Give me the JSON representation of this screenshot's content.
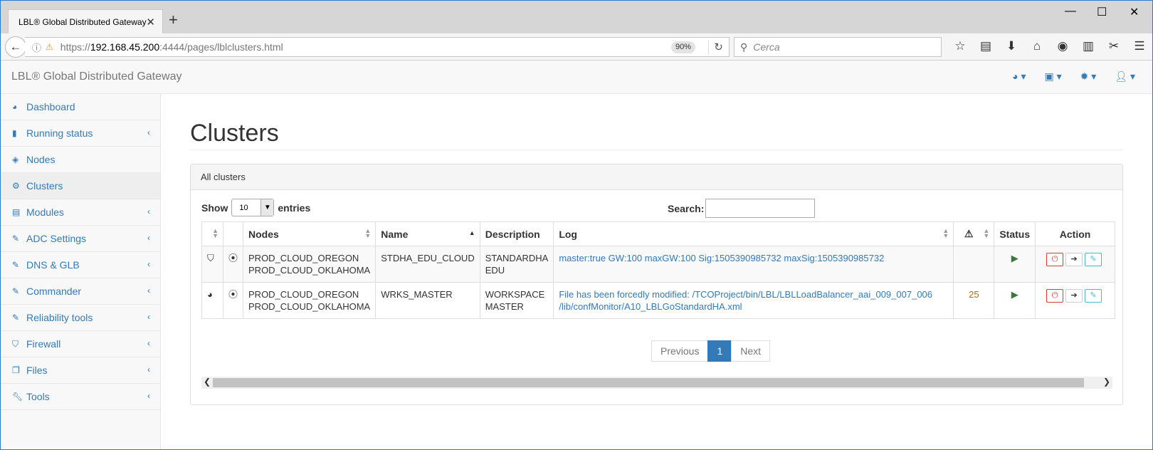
{
  "browser": {
    "tab_title": "LBL® Global Distributed Gateway",
    "url_prefix": "https://",
    "url_host": "192.168.45.200",
    "url_rest": ":4444/pages/lblclusters.html",
    "zoom": "90%",
    "search_placeholder": "Cerca"
  },
  "app": {
    "brand": "LBL® Global Distributed Gateway"
  },
  "sidebar": {
    "items": [
      {
        "label": "Dashboard",
        "icon": "dashboard-icon",
        "chevron": false
      },
      {
        "label": "Running status",
        "icon": "bar-chart-icon",
        "chevron": true
      },
      {
        "label": "Nodes",
        "icon": "cube-icon",
        "chevron": false
      },
      {
        "label": "Clusters",
        "icon": "cogs-icon",
        "chevron": false,
        "active": true
      },
      {
        "label": "Modules",
        "icon": "list-icon",
        "chevron": true
      },
      {
        "label": "ADC Settings",
        "icon": "edit-icon",
        "chevron": true
      },
      {
        "label": "DNS & GLB",
        "icon": "edit-icon",
        "chevron": true
      },
      {
        "label": "Commander",
        "icon": "edit-icon",
        "chevron": true
      },
      {
        "label": "Reliability tools",
        "icon": "edit-icon",
        "chevron": true
      },
      {
        "label": "Firewall",
        "icon": "shield-icon",
        "chevron": true
      },
      {
        "label": "Files",
        "icon": "files-icon",
        "chevron": true
      },
      {
        "label": "Tools",
        "icon": "wrench-icon",
        "chevron": true
      }
    ]
  },
  "page": {
    "title": "Clusters",
    "panel_title": "All clusters",
    "show_label": "Show",
    "entries_value": "10",
    "entries_label": "entries",
    "search_label": "Search:"
  },
  "table": {
    "headers": {
      "nodes": "Nodes",
      "name": "Name",
      "description": "Description",
      "log": "Log",
      "status": "Status",
      "action": "Action"
    },
    "rows": [
      {
        "nodes_1": "PROD_CLOUD_OREGON",
        "nodes_2": "PROD_CLOUD_OKLAHOMA",
        "name": "STDHA_EDU_CLOUD",
        "desc_1": "STANDARDHA",
        "desc_2": "EDU",
        "log_1": "master:true GW:100 maxGW:100 Sig:1505390985732 maxSig:1505390985732",
        "log_2": "",
        "warn": ""
      },
      {
        "nodes_1": "PROD_CLOUD_OREGON",
        "nodes_2": "PROD_CLOUD_OKLAHOMA",
        "name": "WRKS_MASTER",
        "desc_1": "WORKSPACE",
        "desc_2": "MASTER",
        "log_1": "File has been forcedly modified: /TCOProject/bin/LBL/LBLLoadBalancer_aai_009_007_006",
        "log_2": "/lib/confMonitor/A10_LBLGoStandardHA.xml",
        "warn": "25"
      }
    ]
  },
  "pagination": {
    "previous": "Previous",
    "current": "1",
    "next": "Next"
  }
}
